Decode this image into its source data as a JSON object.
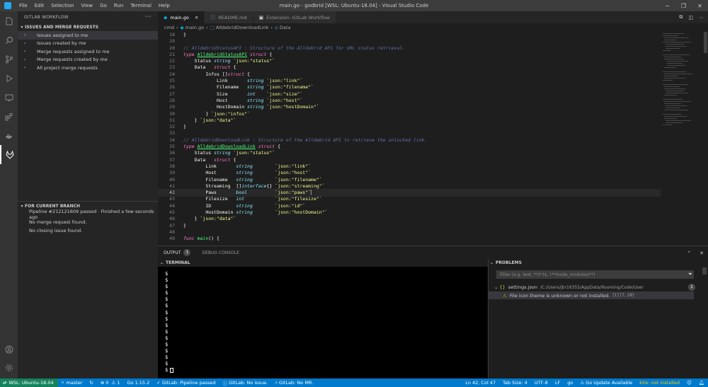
{
  "titlebar": {
    "menus": [
      "File",
      "Edit",
      "Selection",
      "View",
      "Go",
      "Run",
      "Terminal",
      "Help"
    ],
    "title": "main.go - godbrid [WSL: Ubuntu-18.04] - Visual Studio Code"
  },
  "sidebar": {
    "title": "GITLAB WORKFLOW",
    "section1": "ISSUES AND MERGE REQUESTS",
    "items": [
      {
        "label": "Issues assigned to me"
      },
      {
        "label": "Issues created by me"
      },
      {
        "label": "Merge requests assigned to me"
      },
      {
        "label": "Merge requests created by me"
      },
      {
        "label": "All project merge requests"
      }
    ],
    "section2": "FOR CURRENT BRANCH",
    "branch_items": [
      "Pipeline #212121609 passed · Finished a few seconds ago",
      "No merge request found.",
      "No closing issue found."
    ]
  },
  "tabs": [
    {
      "label": "main.go",
      "active": true
    },
    {
      "label": "README.md",
      "active": false
    },
    {
      "label": "Extension: GitLab Workflow",
      "active": false
    }
  ],
  "breadcrumb": [
    "cmd",
    "main.go",
    "AlldebridDownloadLink",
    "Data"
  ],
  "code": {
    "line_numbers": [
      "18",
      "19",
      "20",
      "21",
      "22",
      "23",
      "24",
      "25",
      "26",
      "27",
      "28",
      "29",
      "30",
      "31",
      "32",
      "33",
      "34",
      "35",
      "36",
      "37",
      "38",
      "39",
      "40",
      "41",
      "42",
      "43",
      "44",
      "45",
      "46",
      "47",
      "48",
      "49"
    ],
    "current_line": "42"
  },
  "panel": {
    "tabs": [
      {
        "label": "OUTPUT",
        "badge": "1"
      },
      {
        "label": "DEBUG CONSOLE"
      }
    ],
    "terminal_title": "TERMINAL",
    "problems_title": "PROBLEMS",
    "prompt": "$",
    "filter_placeholder": "Filter (e.g. text, **/*.ts, !**/node_modules/**)",
    "problem_file": "settings.json",
    "problem_path": "/C:/Users/jbr16355/AppData/Roaming/Code/User",
    "problem_count": "1",
    "problem_message": "File icon theme is unknown or not installed.",
    "problem_location": "[1] [7, 28]"
  },
  "statusbar": {
    "remote": "WSL: Ubuntu-18.04",
    "branch": "master",
    "errors": "0",
    "warnings": "1",
    "go_version": "Go 1.15.2",
    "pipeline": "GitLab: Pipeline passed",
    "issue": "GitLab: No issue.",
    "mr": "GitLab: No MR.",
    "position": "Ln 42, Col 47",
    "tab_size": "Tab Size: 4",
    "encoding": "UTF-8",
    "eol": "LF",
    "language": "go",
    "go_update": "Go Update Available",
    "kite": "kite: not installed"
  }
}
